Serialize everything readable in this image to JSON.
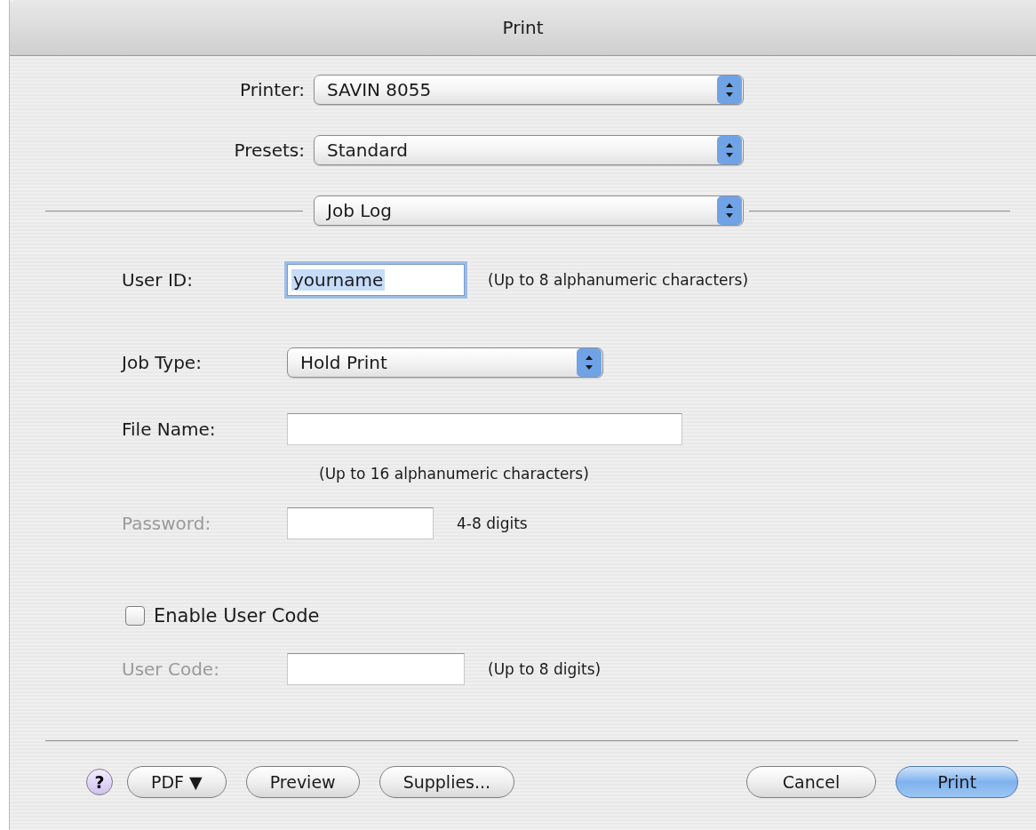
{
  "window": {
    "title": "Print"
  },
  "top_popups": [
    {
      "label": "Printer:",
      "value": "SAVIN 8055"
    },
    {
      "label": "Presets:",
      "value": "Standard"
    }
  ],
  "panel_popup": {
    "value": "Job Log"
  },
  "form": [
    {
      "kind": "text",
      "label": "User ID:",
      "value": "yourname",
      "note": "(Up to 8 alphanumeric characters)",
      "focused": true,
      "disabled": false
    },
    {
      "kind": "popup",
      "label": "Job Type:",
      "value": "Hold Print",
      "disabled": false
    },
    {
      "kind": "text",
      "label": "File Name:",
      "note_below": "(Up to 16 alphanumeric characters)",
      "focused": false,
      "disabled": false
    },
    {
      "kind": "text",
      "label": "Password:",
      "note": "4-8 digits",
      "focused": false,
      "disabled": true
    },
    {
      "kind": "checkbox",
      "label": "Enable User Code",
      "checked": false
    },
    {
      "kind": "text",
      "label": "User Code:",
      "note": "(Up to 8 digits)",
      "focused": false,
      "disabled": true
    }
  ],
  "buttons_left": [
    {
      "kind": "help",
      "label": "?"
    },
    {
      "kind": "push",
      "label": "PDF ▼"
    },
    {
      "kind": "push",
      "label": "Preview"
    },
    {
      "kind": "push",
      "label": "Supplies..."
    }
  ],
  "buttons_right": [
    {
      "kind": "push",
      "label": "Cancel",
      "default": false
    },
    {
      "kind": "push",
      "label": "Print",
      "default": true
    }
  ]
}
